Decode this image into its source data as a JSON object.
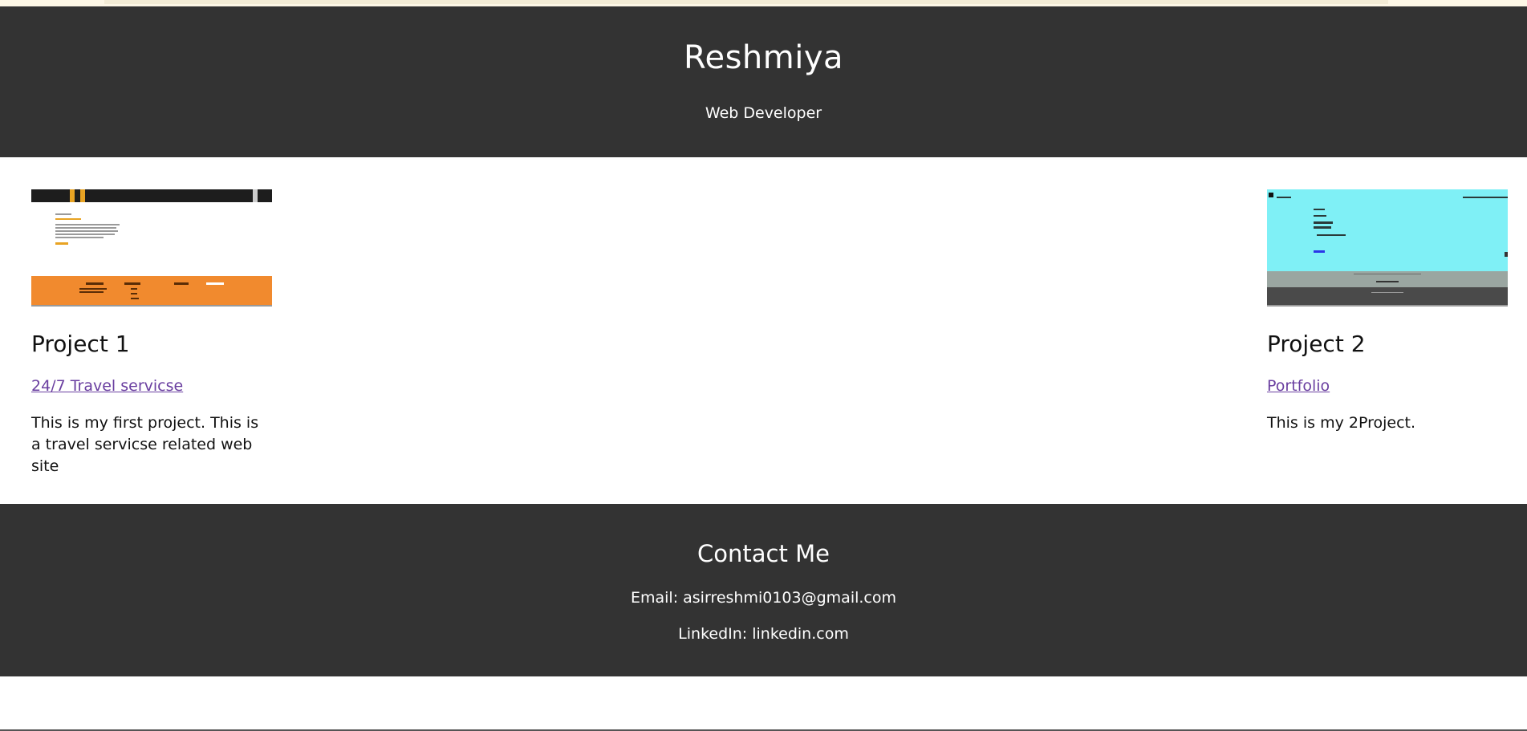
{
  "header": {
    "title": "Reshmiya",
    "subtitle": "Web Developer"
  },
  "projects": [
    {
      "heading": "Project 1",
      "link_text": "24/7 Travel servicse",
      "description": "This is my first project. This is a travel servicse related web site",
      "thumbnail": {
        "accent": "#f18a2e",
        "nav": "#1d1d1d",
        "stripe": "#e8a323"
      }
    },
    {
      "heading": "Project 2",
      "link_text": "Portfolio",
      "description": "This is my 2Project.",
      "thumbnail": {
        "accent": "#7ff0f6",
        "band": "#9aa6a1",
        "foot": "#4a4a4a"
      }
    }
  ],
  "contact": {
    "heading": "Contact Me",
    "email_line": "Email: asirreshmi0103@gmail.com",
    "linkedin_line": "LinkedIn: linkedin.com"
  },
  "colors": {
    "header_bg": "#333333",
    "text_on_dark": "#ffffff",
    "link": "#6a3fa0"
  }
}
